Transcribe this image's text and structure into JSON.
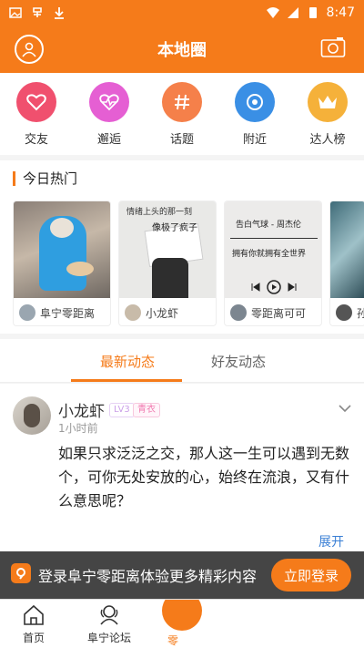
{
  "status_bar": {
    "time": "8:47"
  },
  "header": {
    "title": "本地圈",
    "avatar_icon": "user-icon",
    "camera_icon": "camera-icon"
  },
  "categories": [
    {
      "label": "交友",
      "icon": "heart-icon",
      "color": "#f0506e"
    },
    {
      "label": "邂逅",
      "icon": "heartbeat-icon",
      "color": "#e55fd3"
    },
    {
      "label": "话题",
      "icon": "hash-icon",
      "color": "#f5804a"
    },
    {
      "label": "附近",
      "icon": "location-icon",
      "color": "#3a8fe5"
    },
    {
      "label": "达人榜",
      "icon": "crown-icon",
      "color": "#f5b13a"
    }
  ],
  "hot": {
    "title": "今日热门",
    "cards": [
      {
        "user": "阜宁零距离"
      },
      {
        "user": "小龙虾",
        "caption_top": "情绪上头的那一刻",
        "caption_main": "像极了疯子"
      },
      {
        "user": "零距离可可",
        "caption_top": "告白气球 - 周杰伦",
        "caption_main": "拥有你就拥有全世界"
      },
      {
        "user": "孙"
      }
    ]
  },
  "tabs": {
    "latest": "最新动态",
    "friends": "好友动态"
  },
  "post": {
    "username": "小龙虾",
    "level": "LV3",
    "title_badge": "青衣",
    "time": "1小时前",
    "content": "如果只求泛泛之交，那人这一生可以遇到无数个，可你无处安放的心，始终在流浪，又有什么意思呢？",
    "expand": "展开"
  },
  "banner": {
    "text": "登录阜宁零距离体验更多精彩内容",
    "button": "立即登录"
  },
  "bottom_nav": {
    "home": "首页",
    "forum": "阜宁论坛",
    "center": "零"
  }
}
